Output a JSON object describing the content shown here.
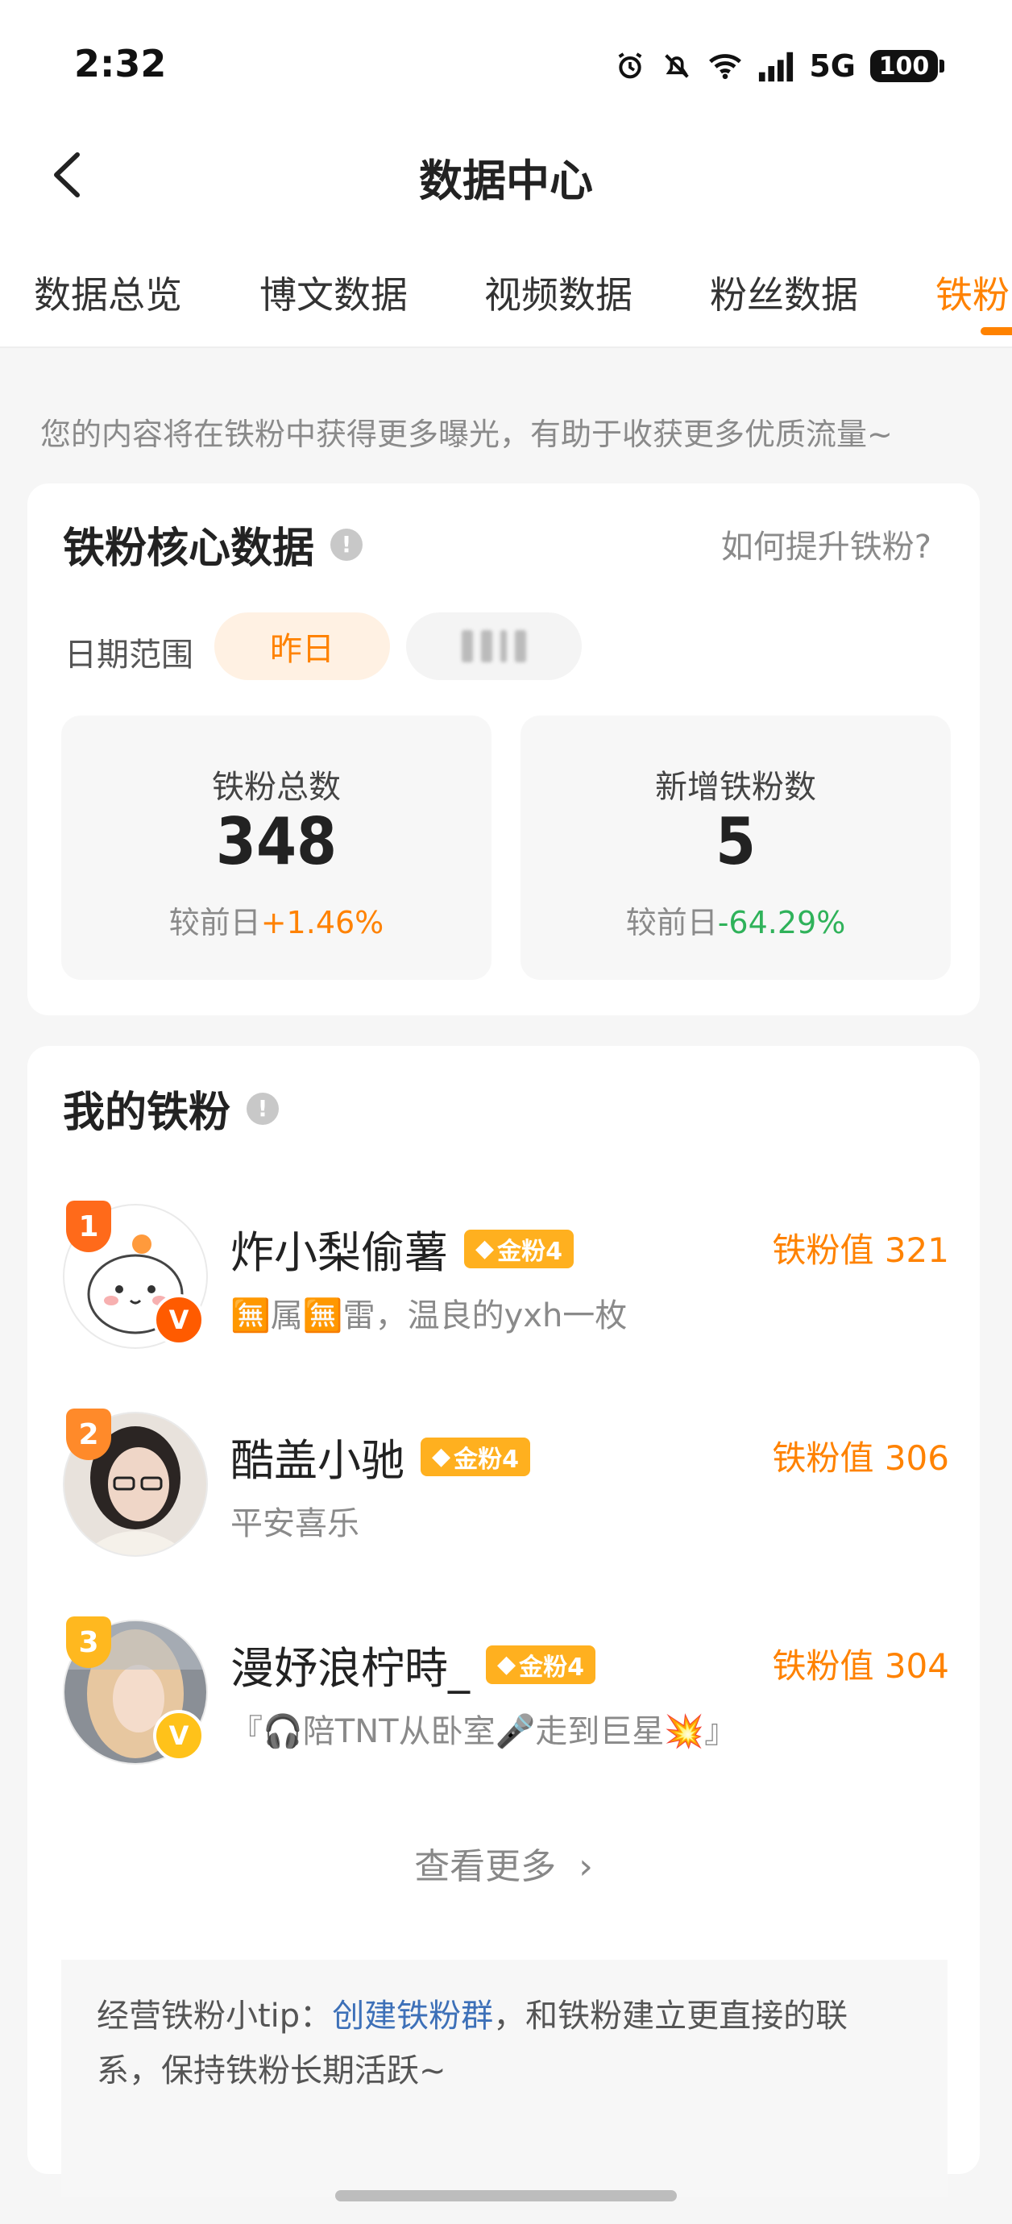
{
  "status": {
    "time": "2:32",
    "network": "5G",
    "battery": "100"
  },
  "header": {
    "title": "数据中心"
  },
  "tabs": [
    "数据总览",
    "博文数据",
    "视频数据",
    "粉丝数据",
    "铁粉"
  ],
  "intro": "您的内容将在铁粉中获得更多曝光，有助于收获更多优质流量~",
  "core": {
    "title": "铁粉核心数据",
    "help": "如何提升铁粉?",
    "date_label": "日期范围",
    "date_selected": "昨日",
    "total": {
      "label": "铁粉总数",
      "value": "348",
      "prefix": "较前日",
      "change": "+1.46%"
    },
    "new": {
      "label": "新增铁粉数",
      "value": "5",
      "prefix": "较前日",
      "change": "-64.29%"
    }
  },
  "my": {
    "title": "我的铁粉",
    "fans": [
      {
        "rank": "1",
        "name": "炸小梨偷薯",
        "badge": "金粉4",
        "desc": "🈚属🈚雷，温良的yxh一枚",
        "score": "铁粉值 321"
      },
      {
        "rank": "2",
        "name": "酷盖小驰",
        "badge": "金粉4",
        "desc": "平安喜乐",
        "score": "铁粉值 306"
      },
      {
        "rank": "3",
        "name": "漫妤浪柠時_",
        "badge": "金粉4",
        "desc": "『🎧陪TNT从卧室🎤走到巨星💥』",
        "score": "铁粉值 304"
      }
    ],
    "more": "查看更多",
    "tip_prefix": "经营铁粉小tip：",
    "tip_link": "创建铁粉群",
    "tip_suffix": "，和铁粉建立更直接的联系，保持铁粉长期活跃~"
  },
  "colors": {
    "accent": "#ff8200",
    "up": "#ff8200",
    "down": "#2fb25a",
    "link": "#3d70b8"
  }
}
